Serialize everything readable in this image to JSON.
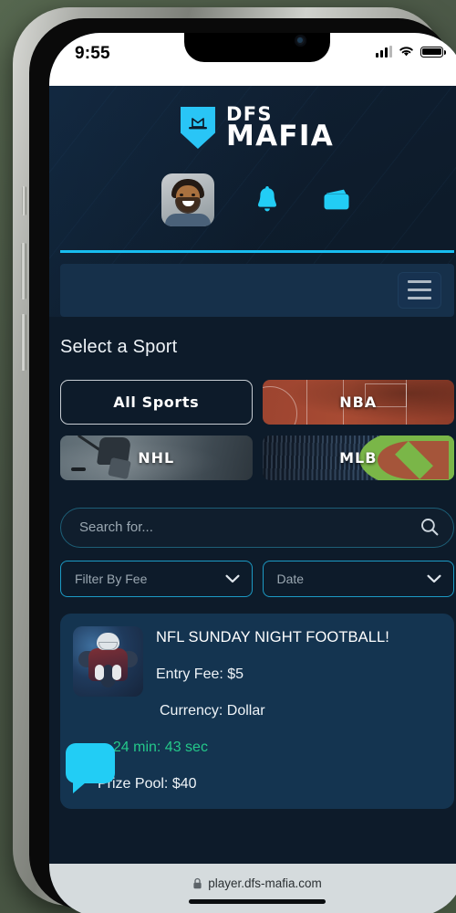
{
  "status_bar": {
    "time": "9:55",
    "signal_icon": "cellular-signal-icon",
    "wifi_icon": "wifi-icon",
    "battery_icon": "battery-full-icon"
  },
  "header": {
    "logo_icon": "mafia-hat-shield-icon",
    "brand_line1": "DFS",
    "brand_line2": "MAFIA",
    "avatar_label": "user-avatar",
    "notifications_icon": "bell-icon",
    "wallet_icon": "wallet-icon",
    "accent_color": "#18bdf0",
    "menu_icon": "hamburger-menu-icon"
  },
  "sports": {
    "section_title": "Select a Sport",
    "cards": [
      {
        "label": "All Sports",
        "style": "outline"
      },
      {
        "label": "NBA",
        "style": "basketball"
      },
      {
        "label": "NHL",
        "style": "hockey"
      },
      {
        "label": "MLB",
        "style": "baseball"
      }
    ]
  },
  "filters": {
    "search_placeholder": "Search for...",
    "search_value": "",
    "search_icon": "search-icon",
    "fee_label": "Filter By Fee",
    "date_label": "Date",
    "chevron_icon": "chevron-down-icon"
  },
  "contest": {
    "thumb_label": "football-player-thumbnail",
    "title": "NFL SUNDAY NIGHT FOOTBALL!",
    "entry_fee": "Entry Fee: $5",
    "currency": "Currency: Dollar",
    "countdown": "s: 24 min: 43 sec",
    "prize_pool": "Prize Pool: $40",
    "countdown_color": "#24c88a"
  },
  "chat_widget": {
    "icon": "chat-bubble-icon",
    "color": "#22cdf5"
  },
  "browser": {
    "lock_icon": "lock-icon",
    "url": "player.dfs-mafia.com"
  }
}
